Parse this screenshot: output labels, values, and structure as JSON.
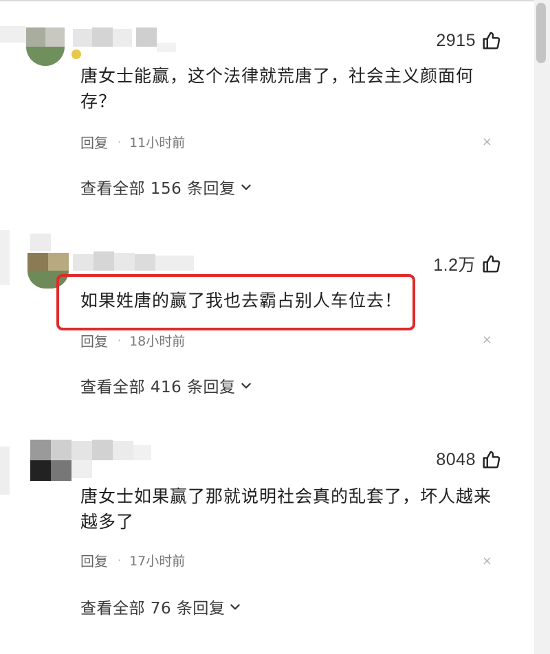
{
  "comments": [
    {
      "likes": "2915",
      "text": "唐女士能赢，这个法律就荒唐了，社会主义颜面何存？",
      "reply_label": "回复",
      "time": "11小时前",
      "close": "×",
      "view_replies": "查看全部 156 条回复"
    },
    {
      "likes": "1.2万",
      "text": "如果姓唐的赢了我也去霸占别人车位去！",
      "reply_label": "回复",
      "time": "18小时前",
      "close": "×",
      "view_replies": "查看全部 416 条回复"
    },
    {
      "likes": "8048",
      "text": "唐女士如果赢了那就说明社会真的乱套了，坏人越来越多了",
      "reply_label": "回复",
      "time": "17小时前",
      "close": "×",
      "view_replies": "查看全部 76 条回复"
    }
  ],
  "icons": {
    "like": "thumbs-up-icon",
    "expand": "chevron-down-icon",
    "close": "close-icon"
  },
  "colors": {
    "highlight": "#e02a2a",
    "text": "#1f1f1f",
    "meta": "#777777"
  }
}
